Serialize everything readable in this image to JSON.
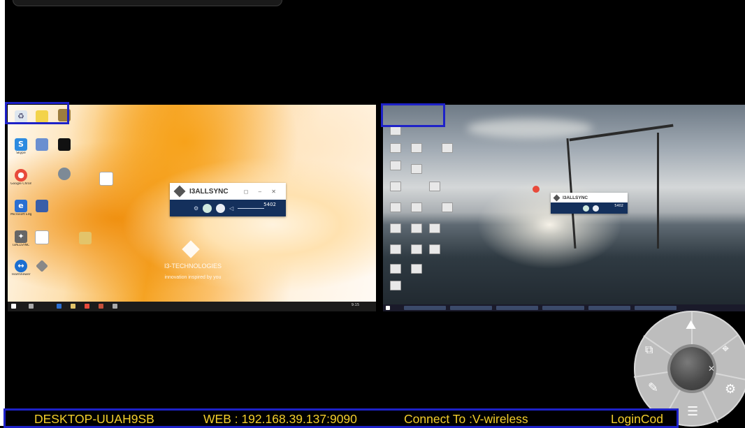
{
  "status_bar": {
    "hostname": "DESKTOP-UUAH9SB",
    "web": "WEB : 192.168.39.137:9090",
    "connect": "Connect To :V-wireless",
    "login": "LoginCod"
  },
  "left_screen": {
    "widget_title": "I3ALLSYNC",
    "widget_code": "5402",
    "brand_caption": "I3-TECHNOLOGIES",
    "brand_tagline": "innovation inspired by you",
    "clock": "9:15",
    "desktop_icons": [
      {
        "label": "Skype",
        "icon": "skype-icon",
        "color": "#2d8be0"
      },
      {
        "label": "Google Chrome",
        "icon": "chrome-icon",
        "color": "#e84a3b"
      },
      {
        "label": "Microsoft Edge",
        "icon": "edge-icon",
        "color": "#2b6fd1"
      },
      {
        "label": "I3ALLSYNC",
        "icon": "i3allsync-icon",
        "color": "#666666"
      },
      {
        "label": "TeamViewer",
        "icon": "teamviewer-icon",
        "color": "#1b6fd1"
      }
    ]
  },
  "right_screen": {
    "widget_title": "I3ALLSYNC",
    "widget_code": "5402"
  },
  "radial_menu": {
    "items": [
      "annotate-icon",
      "screen-share-icon",
      "pen-icon",
      "list-icon",
      "settings-icon",
      "mouse-icon",
      "close-icon"
    ]
  },
  "colors": {
    "highlight": "#1e22c8",
    "status_text": "#f3ce2c",
    "widget_body": "#14305c"
  }
}
